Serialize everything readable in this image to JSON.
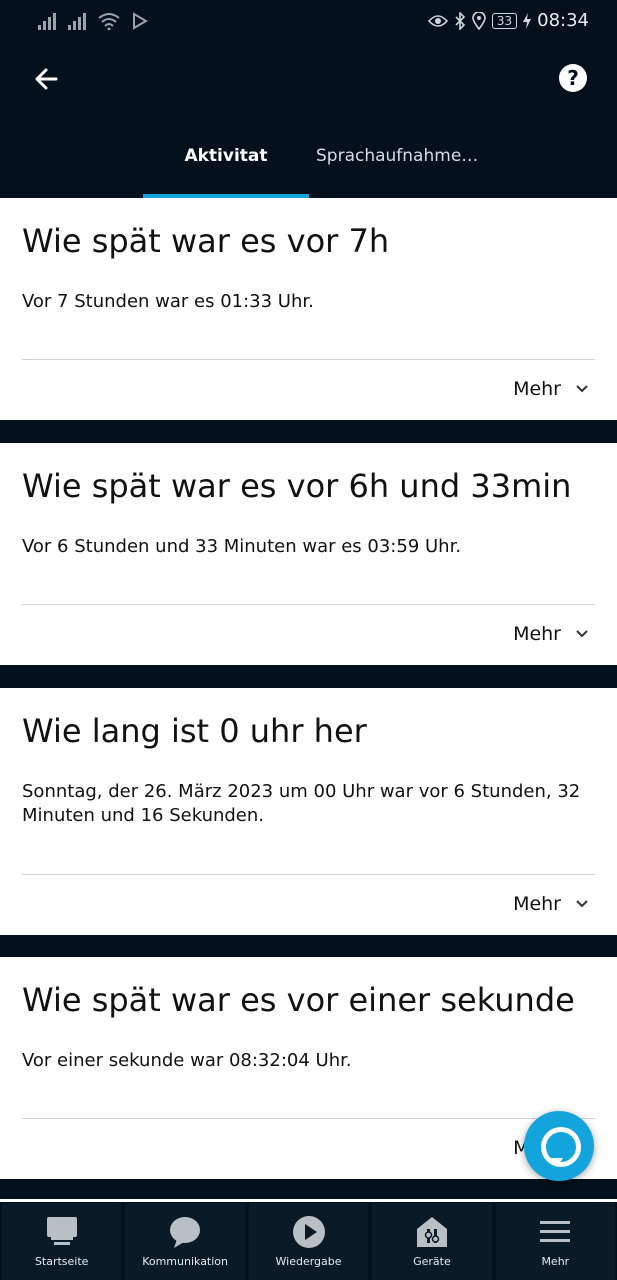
{
  "status": {
    "battery": "33",
    "time": "08:34"
  },
  "header": {
    "tabs": [
      {
        "label": "Aktivitat",
        "active": true
      },
      {
        "label": "Sprachaufnahme…",
        "active": false
      }
    ]
  },
  "cards": [
    {
      "title": "Wie spät war es vor 7h",
      "body": "Vor 7 Stunden war es 01:33 Uhr.",
      "more": "Mehr"
    },
    {
      "title": "Wie spät war es vor 6h und 33min",
      "body": "Vor 6 Stunden und 33 Minuten war es 03:59 Uhr.",
      "more": "Mehr"
    },
    {
      "title": "Wie lang ist 0 uhr her",
      "body": "Sonntag, der 26. März 2023 um 00 Uhr war vor 6 Stunden, 32 Minuten und 16 Sekunden.",
      "more": "Mehr"
    },
    {
      "title": "Wie spät war es vor einer sekunde",
      "body": "Vor einer sekunde war 08:32:04 Uhr.",
      "more": "Mehr"
    }
  ],
  "nav": {
    "items": [
      {
        "label": "Startseite",
        "icon": "home-icon"
      },
      {
        "label": "Kommunikation",
        "icon": "chat-icon"
      },
      {
        "label": "Wiedergabe",
        "icon": "play-icon"
      },
      {
        "label": "Geräte",
        "icon": "devices-icon"
      },
      {
        "label": "Mehr",
        "icon": "menu-icon"
      }
    ]
  },
  "colors": {
    "accent": "#14a4dc",
    "background": "#04111c",
    "card": "#ffffff"
  }
}
